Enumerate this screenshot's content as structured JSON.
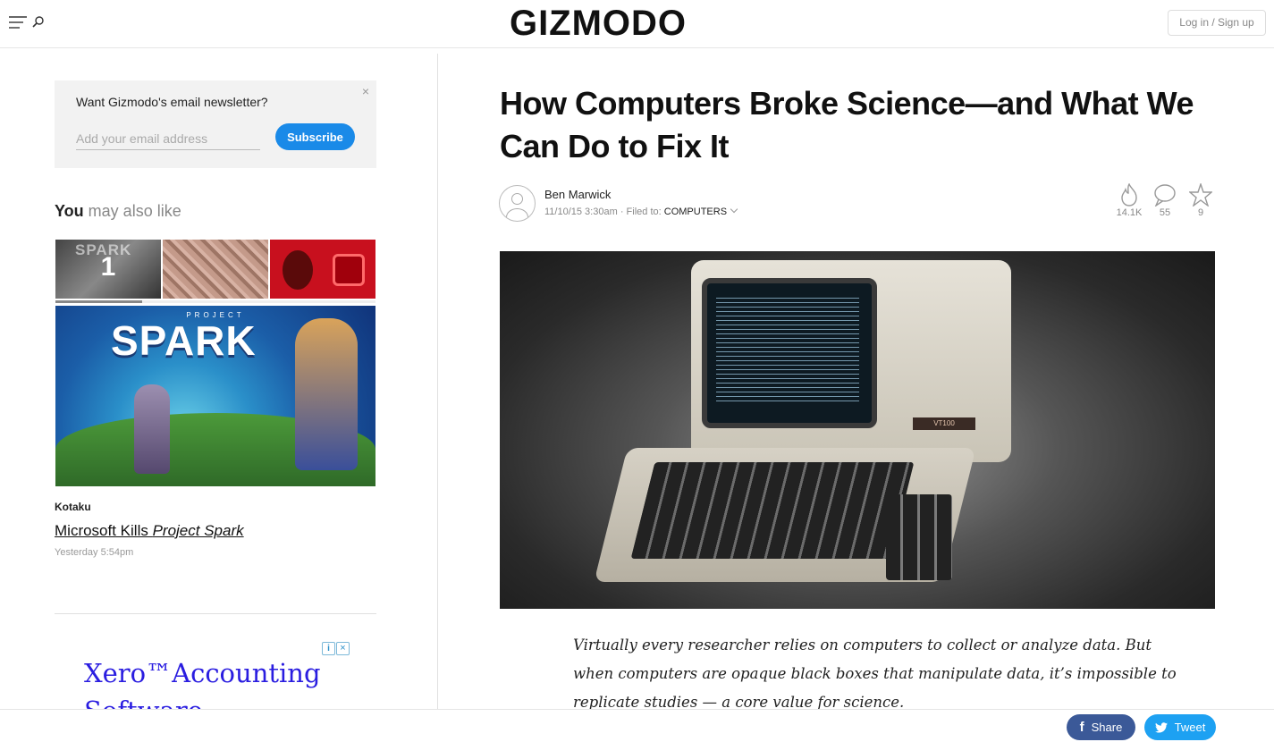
{
  "header": {
    "logo": "GIZMODO",
    "login_label": "Log in / Sign up"
  },
  "newsletter": {
    "title": "Want Gizmodo's email newsletter?",
    "close_glyph": "×",
    "email_placeholder": "Add your email address",
    "subscribe_label": "Subscribe"
  },
  "recommend": {
    "heading_bold": "You",
    "heading_rest": " may also like",
    "carousel_progress": 0.27,
    "thumbs": [
      {
        "label": "SPARK",
        "number": "1"
      },
      {
        "label": ""
      },
      {
        "label": ""
      }
    ],
    "feature": {
      "sub": "PROJECT",
      "title": "SPARK",
      "source": "Kotaku",
      "headline_plain": "Microsoft Kills ",
      "headline_italic": "Project Spark",
      "date": "Yesterday 5:54pm"
    }
  },
  "ad": {
    "info_glyph": "i",
    "close_glyph": "×",
    "text": "Xero™Accounting Software"
  },
  "article": {
    "title": "How Computers Broke Science—and What We Can Do to Fix It",
    "author": "Ben Marwick",
    "date": "11/10/15 3:30am",
    "separator": "·",
    "filed_label": "Filed to:",
    "category": "COMPUTERS",
    "stats": {
      "views": "14.1K",
      "comments": "55",
      "stars": "9"
    },
    "image_badge": "VT100",
    "lede": "Virtually every researcher relies on computers to collect or analyze data. But when computers are opaque black boxes that manipulate data, it’s impossible to replicate studies — a core value for science."
  },
  "share": {
    "facebook_label": "Share",
    "facebook_glyph": "f",
    "twitter_label": "Tweet"
  },
  "colors": {
    "subscribe": "#1a8ae8",
    "facebook": "#3b5998",
    "twitter": "#1da1f2",
    "ad_link": "#2a1de0"
  }
}
